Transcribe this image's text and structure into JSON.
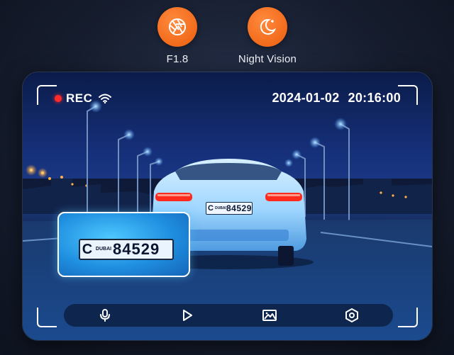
{
  "features": [
    {
      "label": "F1.8",
      "icon": "aperture-icon"
    },
    {
      "label": "Night Vision",
      "icon": "moon-stars-icon"
    }
  ],
  "accent_color": "#f26a1b",
  "screen": {
    "status": {
      "rec_label": "REC",
      "rec_color": "#ff2a2a",
      "wifi_icon": "wifi-icon"
    },
    "timestamp": {
      "date": "2024-01-02",
      "time": "20:16:00"
    },
    "license_plate": {
      "letter": "C",
      "city": "DUBAI",
      "number": "84529"
    },
    "toolbar": [
      "microphone-icon",
      "play-icon",
      "gallery-icon",
      "settings-hexagon-icon"
    ]
  }
}
